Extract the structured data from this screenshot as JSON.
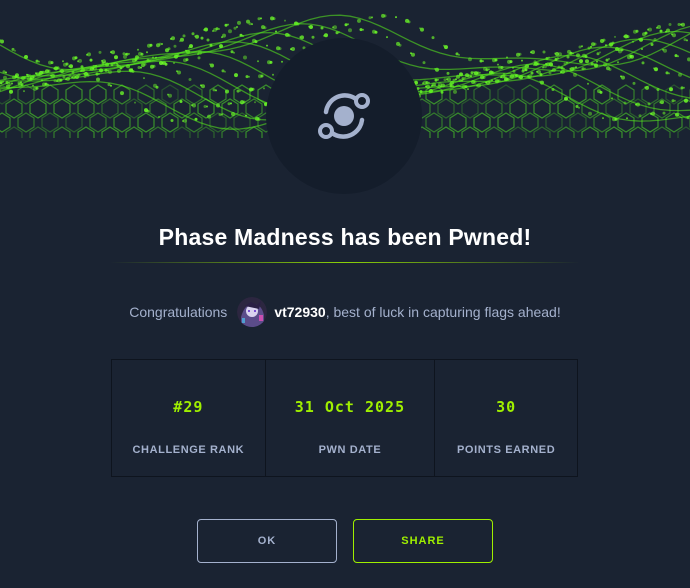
{
  "modal": {
    "title": "Phase Madness has been Pwned!"
  },
  "congrats": {
    "prefix": "Congratulations",
    "username": "vt72930",
    "suffix": ", best of luck in capturing flags ahead!"
  },
  "stats": [
    {
      "value": "#29",
      "label": "CHALLENGE RANK"
    },
    {
      "value": "31 Oct 2025",
      "label": "PWN DATE"
    },
    {
      "value": "30",
      "label": "POINTS EARNED"
    }
  ],
  "buttons": {
    "ok_label": "OK",
    "share_label": "SHARE"
  },
  "icons": {
    "badge": "orbit-icon",
    "avatar": "user-avatar"
  },
  "colors": {
    "background": "#1a2332",
    "accent": "#9fef00",
    "muted_text": "#a4b1cd",
    "badge_bg": "#141d2b"
  }
}
